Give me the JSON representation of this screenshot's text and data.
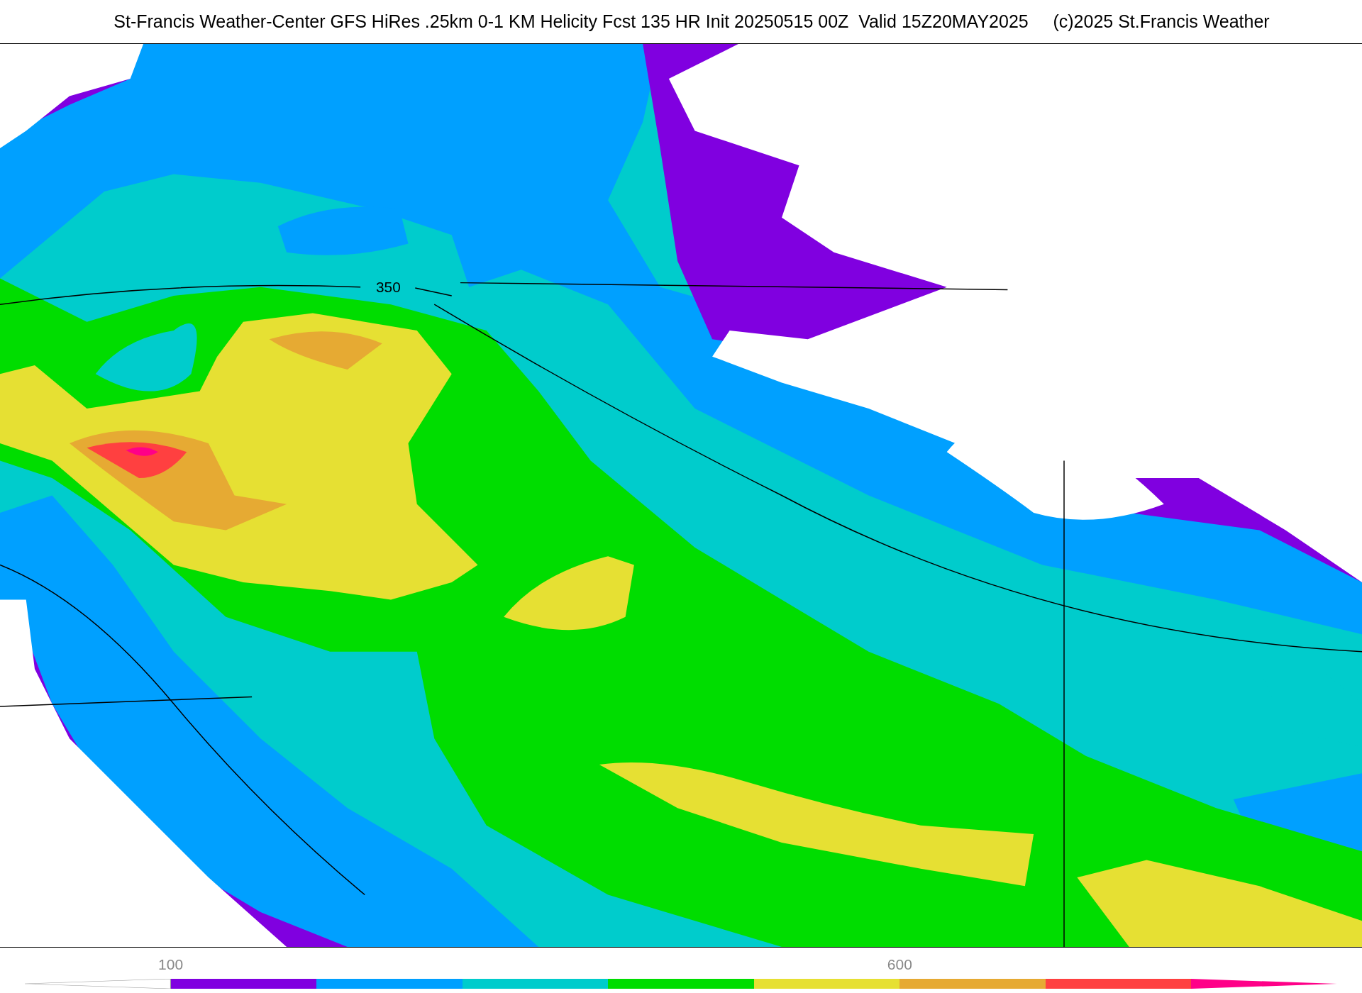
{
  "title": "St-Francis Weather-Center GFS HiRes .25km 0-1 KM Helicity Fcst 135 HR Init 20250515 00Z  Valid 15Z20MAY2025     (c)2025 St.Francis Weather",
  "map": {
    "contour_label": "350"
  },
  "colorbar": [
    {
      "kind": "start",
      "color": "#ffffff"
    },
    {
      "kind": "bar",
      "color": "#8000e0",
      "tick": "100"
    },
    {
      "kind": "bar",
      "color": "#00a0ff"
    },
    {
      "kind": "bar",
      "color": "#00cccc"
    },
    {
      "kind": "bar",
      "color": "#00dd00"
    },
    {
      "kind": "bar",
      "color": "#e6e033"
    },
    {
      "kind": "bar",
      "color": "#e6aa33",
      "tick": "600"
    },
    {
      "kind": "bar",
      "color": "#ff4040"
    },
    {
      "kind": "end",
      "color": "#ff0088"
    }
  ]
}
